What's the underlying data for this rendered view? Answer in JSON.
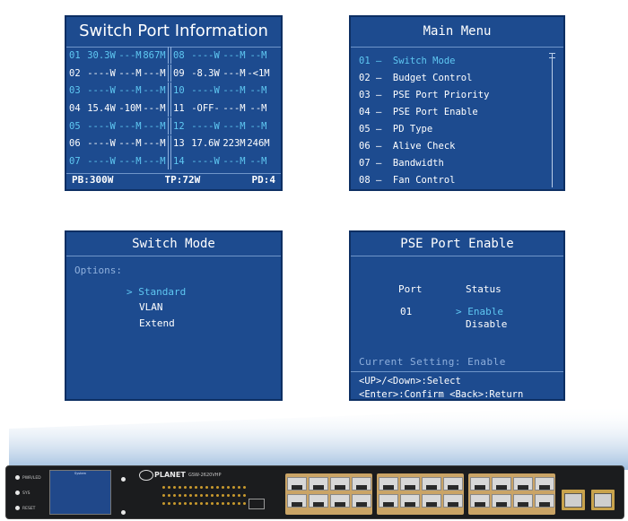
{
  "switch_port_info": {
    "title": "Switch Port Information",
    "rows": [
      {
        "l_port": "01",
        "l_power": "30.3W",
        "l_speed": "---M",
        "l_bw": "867M",
        "r_port": "08",
        "r_power": "----W",
        "r_speed": "---M",
        "r_bw": "--M",
        "highlight": true
      },
      {
        "l_port": "02",
        "l_power": "----W",
        "l_speed": "---M",
        "l_bw": "---M",
        "r_port": "09",
        "r_power": "-8.3W",
        "r_speed": "---M",
        "r_bw": "-<1M",
        "highlight": false
      },
      {
        "l_port": "03",
        "l_power": "----W",
        "l_speed": "---M",
        "l_bw": "---M",
        "r_port": "10",
        "r_power": "----W",
        "r_speed": "---M",
        "r_bw": "--M",
        "highlight": true
      },
      {
        "l_port": "04",
        "l_power": "15.4W",
        "l_speed": "-10M",
        "l_bw": "---M",
        "r_port": "11",
        "r_power": "-OFF-",
        "r_speed": "---M",
        "r_bw": "--M",
        "highlight": false
      },
      {
        "l_port": "05",
        "l_power": "----W",
        "l_speed": "---M",
        "l_bw": "---M",
        "r_port": "12",
        "r_power": "----W",
        "r_speed": "---M",
        "r_bw": "--M",
        "highlight": true
      },
      {
        "l_port": "06",
        "l_power": "----W",
        "l_speed": "---M",
        "l_bw": "---M",
        "r_port": "13",
        "r_power": "17.6W",
        "r_speed": "223M",
        "r_bw": "246M",
        "highlight": false
      },
      {
        "l_port": "07",
        "l_power": "----W",
        "l_speed": "---M",
        "l_bw": "---M",
        "r_port": "14",
        "r_power": "----W",
        "r_speed": "---M",
        "r_bw": "--M",
        "highlight": true
      }
    ],
    "footer": {
      "pb": "PB:300W",
      "tp": "TP:72W",
      "pd": "PD:4"
    }
  },
  "main_menu": {
    "title": "Main Menu",
    "items": [
      "01 —  Switch Mode",
      "02 —  Budget Control",
      "03 —  PSE Port Priority",
      "04 —  PSE Port Enable",
      "05 —  PD Type",
      "06 —  Alive Check",
      "07 —  Bandwidth",
      "08 —  Fan Control"
    ],
    "selected_index": 0
  },
  "switch_mode": {
    "title": "Switch Mode",
    "options_label": "Options:",
    "options": [
      "> Standard",
      "VLAN",
      "Extend"
    ],
    "selected_index": 0
  },
  "pse_port_enable": {
    "title": "PSE Port Enable",
    "port_header": "Port",
    "status_header": "Status",
    "port_value": "01",
    "status_options": [
      "> Enable",
      "Disable"
    ],
    "current_setting": "Current Setting: Enable",
    "hint_line1": "<UP>/<Down>:Select",
    "hint_line2": "<Enter>:Confirm <Back>:Return"
  },
  "device": {
    "brand": "PLANET",
    "model": "GSW-2620VHP",
    "lcd_title": "System",
    "left_labels": [
      "PWR/LED",
      "SYS",
      "RESET"
    ],
    "colors": {
      "panel": "#1d4b8f",
      "highlight": "#5fc8f2",
      "device_body": "#1b1c1e",
      "port_block": "#caa466"
    }
  }
}
